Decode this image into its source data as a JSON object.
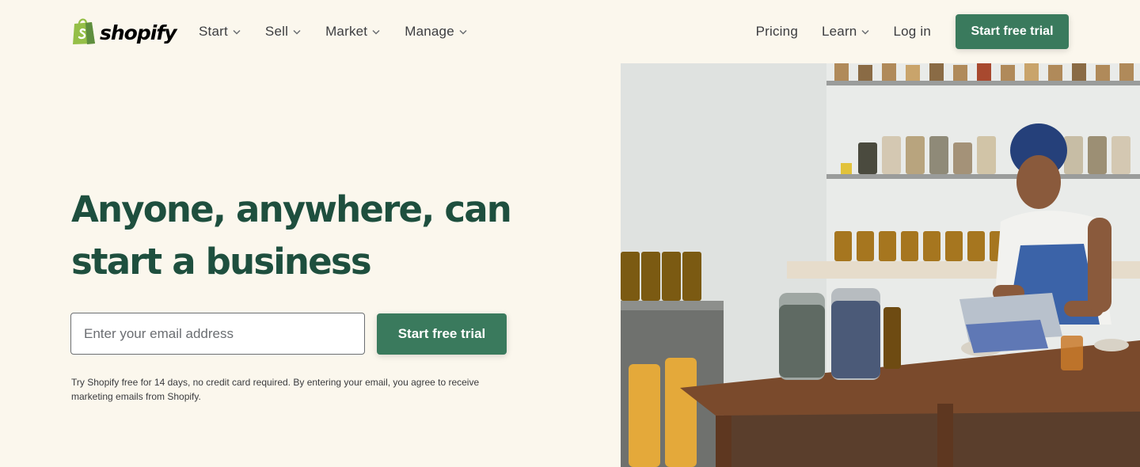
{
  "brand": {
    "name": "shopify",
    "accent_color": "#3a7a5d",
    "headline_color": "#1e4f3e",
    "background_color": "#fbf7ed"
  },
  "nav": {
    "left": [
      {
        "label": "Start",
        "icon": "chevron-down-icon"
      },
      {
        "label": "Sell",
        "icon": "chevron-down-icon"
      },
      {
        "label": "Market",
        "icon": "chevron-down-icon"
      },
      {
        "label": "Manage",
        "icon": "chevron-down-icon"
      }
    ],
    "right": {
      "pricing": "Pricing",
      "learn": "Learn",
      "login": "Log in",
      "cta": "Start free trial"
    }
  },
  "hero": {
    "title_line1": "Anyone, anywhere, can",
    "title_line2": "start a business",
    "email_placeholder": "Enter your email address",
    "cta": "Start free trial",
    "disclaimer_line1": "Try Shopify free for 14 days, no credit card required. By entering your email, you agree to receive",
    "disclaimer_line2": "marketing emails from Shopify."
  },
  "image": {
    "subject": "woman-working-on-tablet-in-shop-with-jars"
  }
}
